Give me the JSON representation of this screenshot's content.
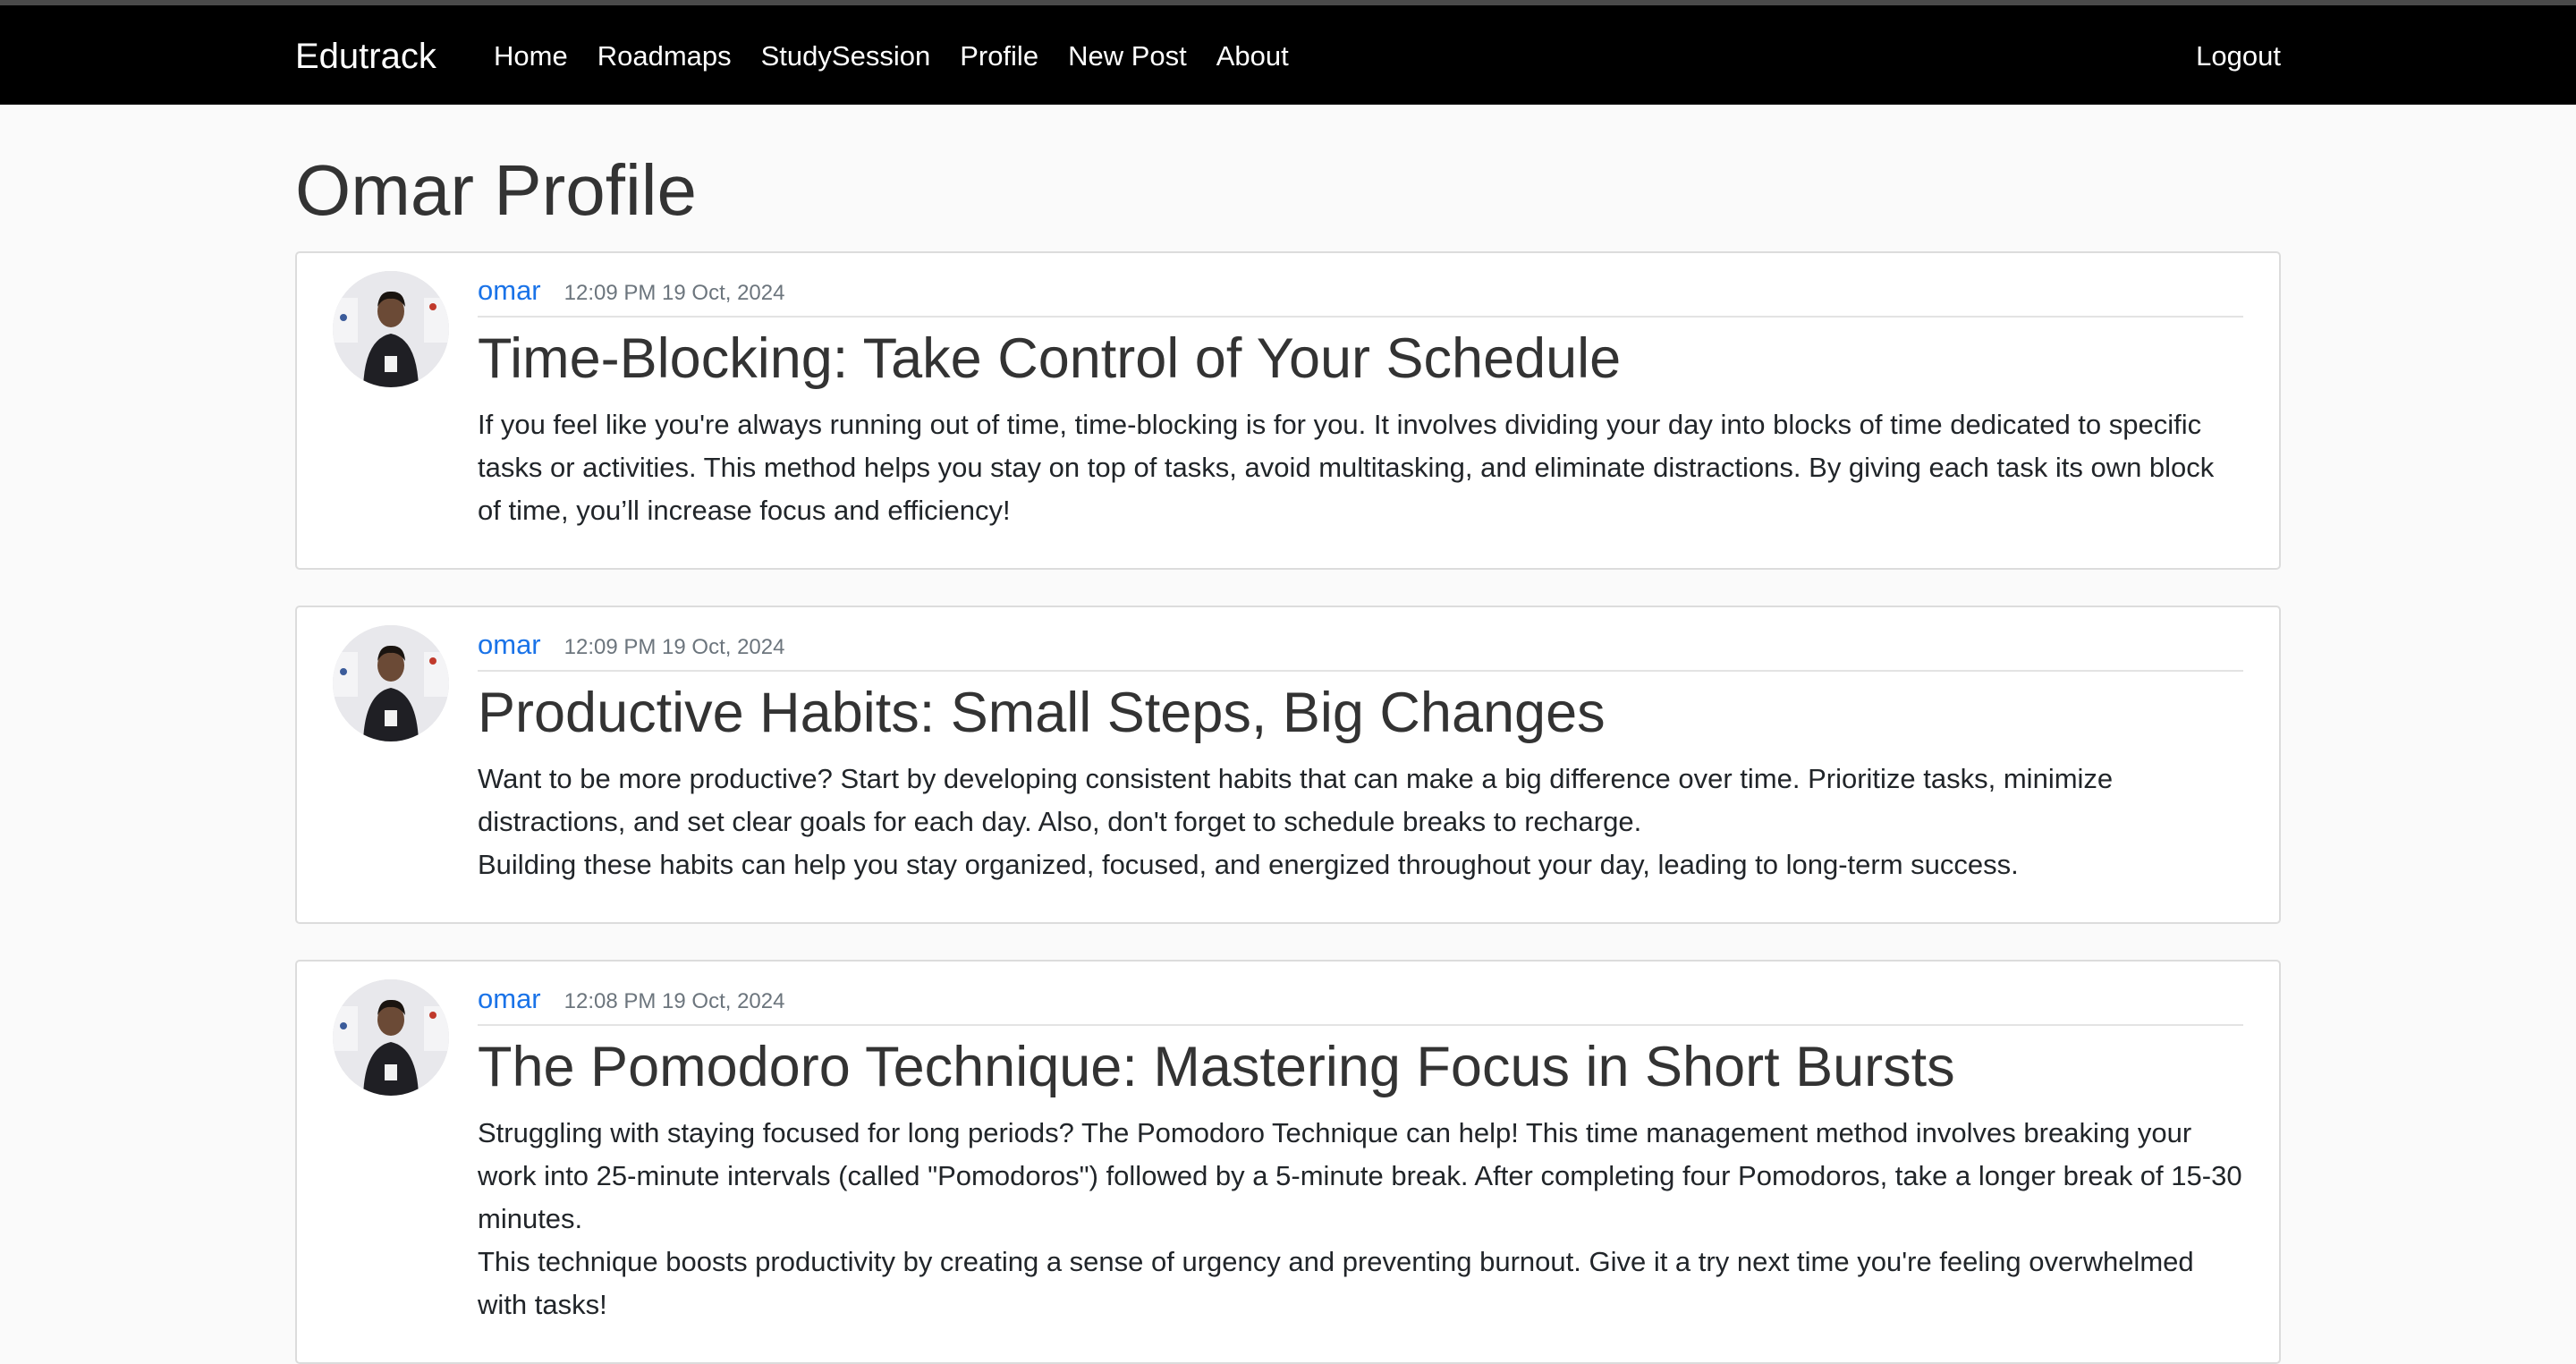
{
  "nav": {
    "brand": "Edutrack",
    "links": [
      "Home",
      "Roadmaps",
      "StudySession",
      "Profile",
      "New Post",
      "About"
    ],
    "logout": "Logout"
  },
  "page": {
    "title": "Omar Profile"
  },
  "posts": [
    {
      "author": "omar",
      "date": "12:09 PM 19 Oct, 2024",
      "title": "Time-Blocking: Take Control of Your Schedule",
      "paragraphs": [
        "If you feel like you're always running out of time, time-blocking is for you. It involves dividing your day into blocks of time dedicated to specific tasks or activities. This method helps you stay on top of tasks, avoid multitasking, and eliminate distractions. By giving each task its own block of time, you’ll increase focus and efficiency!"
      ]
    },
    {
      "author": "omar",
      "date": "12:09 PM 19 Oct, 2024",
      "title": "Productive Habits: Small Steps, Big Changes",
      "paragraphs": [
        "Want to be more productive? Start by developing consistent habits that can make a big difference over time. Prioritize tasks, minimize distractions, and set clear goals for each day. Also, don't forget to schedule breaks to recharge.",
        "Building these habits can help you stay organized, focused, and energized throughout your day, leading to long-term success."
      ]
    },
    {
      "author": "omar",
      "date": "12:08 PM 19 Oct, 2024",
      "title": "The Pomodoro Technique: Mastering Focus in Short Bursts",
      "paragraphs": [
        "Struggling with staying focused for long periods? The Pomodoro Technique can help! This time management method involves breaking your work into 25-minute intervals (called \"Pomodoros\") followed by a 5-minute break. After completing four Pomodoros, take a longer break of 15-30 minutes.",
        "This technique boosts productivity by creating a sense of urgency and preventing burnout. Give it a try next time you're feeling overwhelmed with tasks!"
      ]
    }
  ]
}
